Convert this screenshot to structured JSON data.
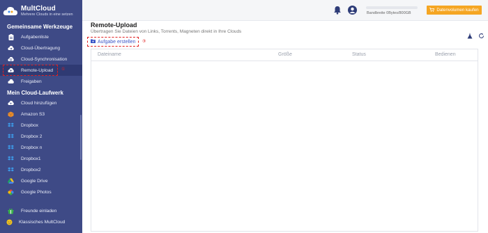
{
  "brand": {
    "name": "MultCloud",
    "slogan": "Mehrere Clouds in eine setzen"
  },
  "sidebar": {
    "section1_title": "Gemeinsame Werkzeuge",
    "tools": [
      {
        "label": "Aufgabenliste",
        "icon": "clipboard-icon"
      },
      {
        "label": "Cloud-Übertragung",
        "icon": "transfer-icon"
      },
      {
        "label": "Cloud-Synchronisation",
        "icon": "sync-icon"
      },
      {
        "label": "Remote-Upload",
        "icon": "cloud-upload-icon",
        "active": true,
        "step": "①"
      },
      {
        "label": "Freigaben",
        "icon": "share-cloud-icon"
      }
    ],
    "section2_title": "Mein Cloud-Laufwerk",
    "drives": [
      {
        "label": "Cloud hinzufügen",
        "icon": "add-cloud-icon"
      },
      {
        "label": "Amazon S3",
        "icon": "amazon-s3-icon"
      },
      {
        "label": "Dropbox",
        "icon": "dropbox-icon"
      },
      {
        "label": "Dropbox 2",
        "icon": "dropbox-icon"
      },
      {
        "label": "Dropbox n",
        "icon": "dropbox-icon"
      },
      {
        "label": "Dropbox1",
        "icon": "dropbox-icon"
      },
      {
        "label": "Dropbox2",
        "icon": "dropbox-icon"
      },
      {
        "label": "Google Drive",
        "icon": "google-drive-icon"
      },
      {
        "label": "Google Photos",
        "icon": "google-photos-icon"
      }
    ],
    "footer": [
      {
        "label": "Freunde einladen",
        "icon": "gift-icon"
      },
      {
        "label": "Klassisches MultCloud",
        "icon": "smile-icon"
      }
    ]
  },
  "topbar": {
    "bandwidth": "Bandbreite 0Bytes/800GB",
    "upgrade": "Datenvolumen kaufen"
  },
  "main": {
    "title": "Remote-Upload",
    "subtitle": "Übertragen Sie Dateien von Links, Torrents, Magneten direkt in Ihre Clouds",
    "create_task": "Aufgabe erstellen",
    "create_step": "③",
    "columns": [
      "Dateiname",
      "Größe",
      "Status",
      "Bedienen"
    ]
  },
  "colors": {
    "sidebar_bg": "#3e4a86",
    "accent_orange": "#f5a623",
    "highlight_red": "#e02020",
    "link_blue": "#3a55c7"
  }
}
